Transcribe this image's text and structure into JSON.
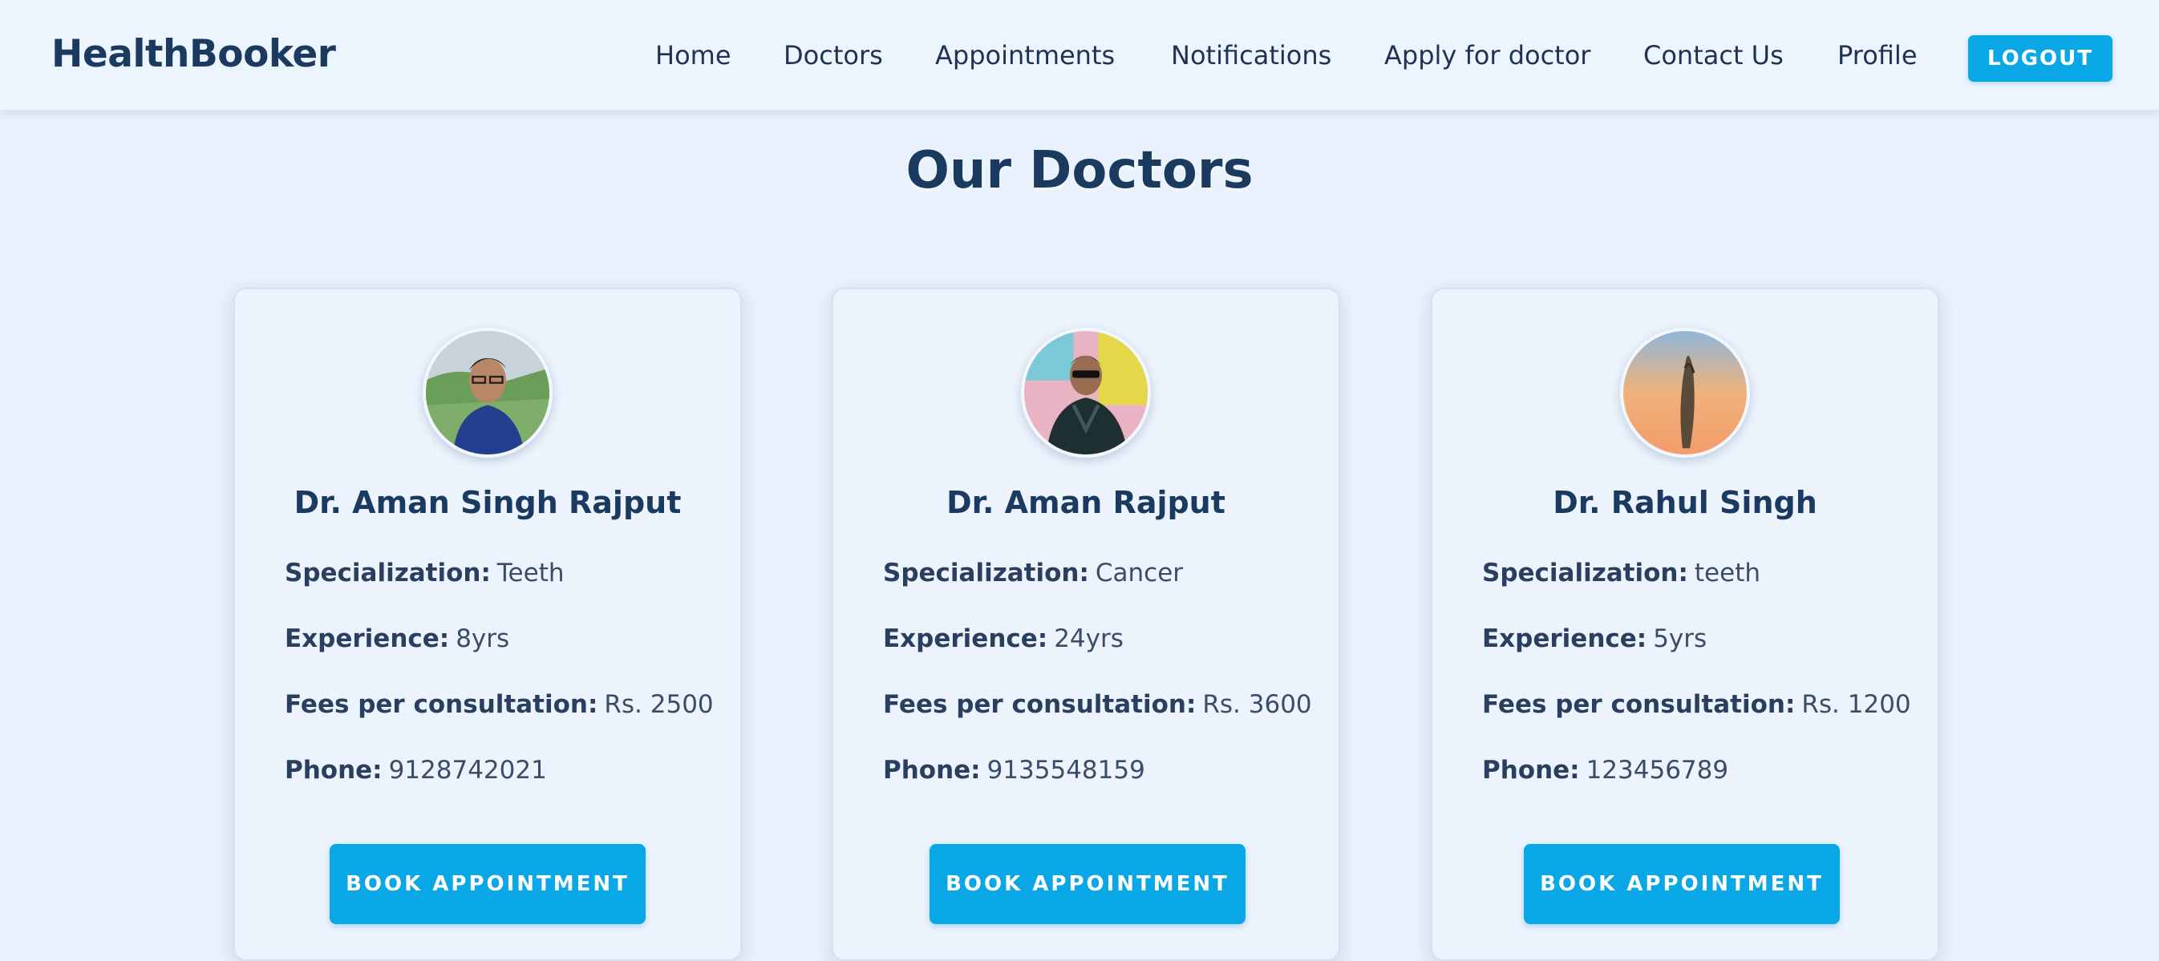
{
  "navbar": {
    "brand": "HealthBooker",
    "links": [
      "Home",
      "Doctors",
      "Appointments",
      "Notifications",
      "Apply for doctor",
      "Contact Us",
      "Profile"
    ],
    "logout_label": "LOGOUT"
  },
  "page": {
    "title": "Our Doctors"
  },
  "labels": {
    "specialization": "Specialization:",
    "experience": "Experience:",
    "fees": "Fees per consultation:",
    "phone": "Phone:"
  },
  "doctors": [
    {
      "name": "Dr. Aman Singh Rajput",
      "specialization": "Teeth",
      "experience": "8yrs",
      "fees": "Rs. 2500",
      "phone": "9128742021",
      "button_label": "BOOK APPOINTMENT"
    },
    {
      "name": "Dr. Aman Rajput",
      "specialization": "Cancer",
      "experience": "24yrs",
      "fees": "Rs. 3600",
      "phone": "9135548159",
      "button_label": "BOOK APPOINTMENT"
    },
    {
      "name": "Dr. Rahul Singh",
      "specialization": "teeth",
      "experience": "5yrs",
      "fees": "Rs. 1200",
      "phone": "123456789",
      "button_label": "BOOK APPOINTMENT"
    }
  ],
  "colors": {
    "accent": "#0aa7e6",
    "heading": "#1b3a5f",
    "background": "#e8f1fc"
  }
}
